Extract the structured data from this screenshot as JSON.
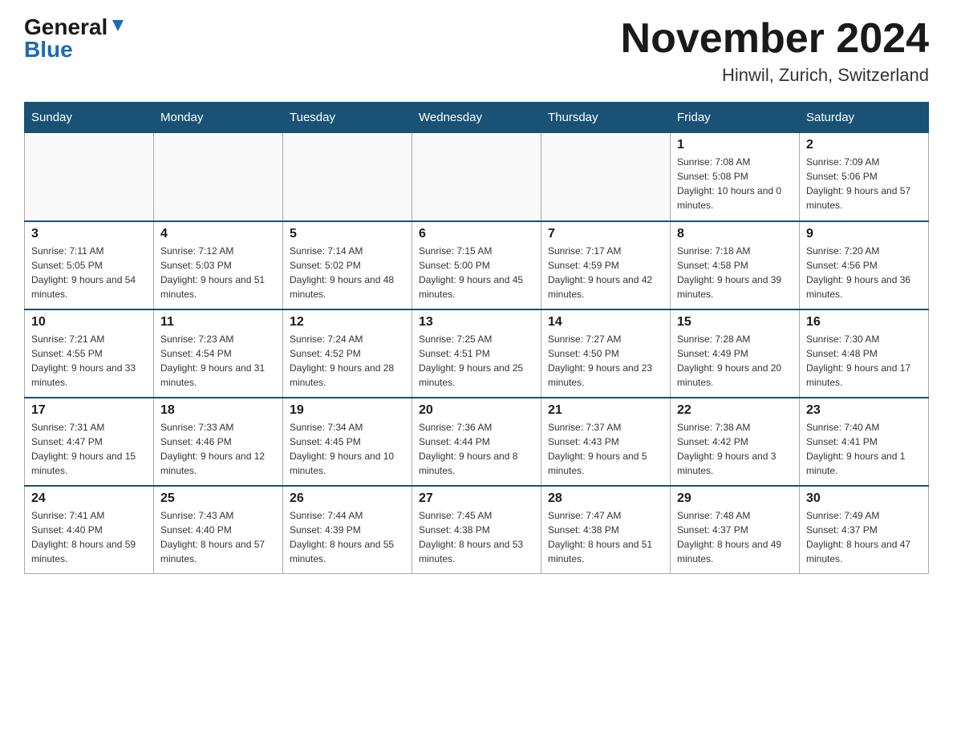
{
  "header": {
    "logo_general": "General",
    "logo_blue": "Blue",
    "month_title": "November 2024",
    "location": "Hinwil, Zurich, Switzerland"
  },
  "weekdays": [
    "Sunday",
    "Monday",
    "Tuesday",
    "Wednesday",
    "Thursday",
    "Friday",
    "Saturday"
  ],
  "weeks": [
    [
      {
        "day": "",
        "info": ""
      },
      {
        "day": "",
        "info": ""
      },
      {
        "day": "",
        "info": ""
      },
      {
        "day": "",
        "info": ""
      },
      {
        "day": "",
        "info": ""
      },
      {
        "day": "1",
        "info": "Sunrise: 7:08 AM\nSunset: 5:08 PM\nDaylight: 10 hours and 0 minutes."
      },
      {
        "day": "2",
        "info": "Sunrise: 7:09 AM\nSunset: 5:06 PM\nDaylight: 9 hours and 57 minutes."
      }
    ],
    [
      {
        "day": "3",
        "info": "Sunrise: 7:11 AM\nSunset: 5:05 PM\nDaylight: 9 hours and 54 minutes."
      },
      {
        "day": "4",
        "info": "Sunrise: 7:12 AM\nSunset: 5:03 PM\nDaylight: 9 hours and 51 minutes."
      },
      {
        "day": "5",
        "info": "Sunrise: 7:14 AM\nSunset: 5:02 PM\nDaylight: 9 hours and 48 minutes."
      },
      {
        "day": "6",
        "info": "Sunrise: 7:15 AM\nSunset: 5:00 PM\nDaylight: 9 hours and 45 minutes."
      },
      {
        "day": "7",
        "info": "Sunrise: 7:17 AM\nSunset: 4:59 PM\nDaylight: 9 hours and 42 minutes."
      },
      {
        "day": "8",
        "info": "Sunrise: 7:18 AM\nSunset: 4:58 PM\nDaylight: 9 hours and 39 minutes."
      },
      {
        "day": "9",
        "info": "Sunrise: 7:20 AM\nSunset: 4:56 PM\nDaylight: 9 hours and 36 minutes."
      }
    ],
    [
      {
        "day": "10",
        "info": "Sunrise: 7:21 AM\nSunset: 4:55 PM\nDaylight: 9 hours and 33 minutes."
      },
      {
        "day": "11",
        "info": "Sunrise: 7:23 AM\nSunset: 4:54 PM\nDaylight: 9 hours and 31 minutes."
      },
      {
        "day": "12",
        "info": "Sunrise: 7:24 AM\nSunset: 4:52 PM\nDaylight: 9 hours and 28 minutes."
      },
      {
        "day": "13",
        "info": "Sunrise: 7:25 AM\nSunset: 4:51 PM\nDaylight: 9 hours and 25 minutes."
      },
      {
        "day": "14",
        "info": "Sunrise: 7:27 AM\nSunset: 4:50 PM\nDaylight: 9 hours and 23 minutes."
      },
      {
        "day": "15",
        "info": "Sunrise: 7:28 AM\nSunset: 4:49 PM\nDaylight: 9 hours and 20 minutes."
      },
      {
        "day": "16",
        "info": "Sunrise: 7:30 AM\nSunset: 4:48 PM\nDaylight: 9 hours and 17 minutes."
      }
    ],
    [
      {
        "day": "17",
        "info": "Sunrise: 7:31 AM\nSunset: 4:47 PM\nDaylight: 9 hours and 15 minutes."
      },
      {
        "day": "18",
        "info": "Sunrise: 7:33 AM\nSunset: 4:46 PM\nDaylight: 9 hours and 12 minutes."
      },
      {
        "day": "19",
        "info": "Sunrise: 7:34 AM\nSunset: 4:45 PM\nDaylight: 9 hours and 10 minutes."
      },
      {
        "day": "20",
        "info": "Sunrise: 7:36 AM\nSunset: 4:44 PM\nDaylight: 9 hours and 8 minutes."
      },
      {
        "day": "21",
        "info": "Sunrise: 7:37 AM\nSunset: 4:43 PM\nDaylight: 9 hours and 5 minutes."
      },
      {
        "day": "22",
        "info": "Sunrise: 7:38 AM\nSunset: 4:42 PM\nDaylight: 9 hours and 3 minutes."
      },
      {
        "day": "23",
        "info": "Sunrise: 7:40 AM\nSunset: 4:41 PM\nDaylight: 9 hours and 1 minute."
      }
    ],
    [
      {
        "day": "24",
        "info": "Sunrise: 7:41 AM\nSunset: 4:40 PM\nDaylight: 8 hours and 59 minutes."
      },
      {
        "day": "25",
        "info": "Sunrise: 7:43 AM\nSunset: 4:40 PM\nDaylight: 8 hours and 57 minutes."
      },
      {
        "day": "26",
        "info": "Sunrise: 7:44 AM\nSunset: 4:39 PM\nDaylight: 8 hours and 55 minutes."
      },
      {
        "day": "27",
        "info": "Sunrise: 7:45 AM\nSunset: 4:38 PM\nDaylight: 8 hours and 53 minutes."
      },
      {
        "day": "28",
        "info": "Sunrise: 7:47 AM\nSunset: 4:38 PM\nDaylight: 8 hours and 51 minutes."
      },
      {
        "day": "29",
        "info": "Sunrise: 7:48 AM\nSunset: 4:37 PM\nDaylight: 8 hours and 49 minutes."
      },
      {
        "day": "30",
        "info": "Sunrise: 7:49 AM\nSunset: 4:37 PM\nDaylight: 8 hours and 47 minutes."
      }
    ]
  ]
}
